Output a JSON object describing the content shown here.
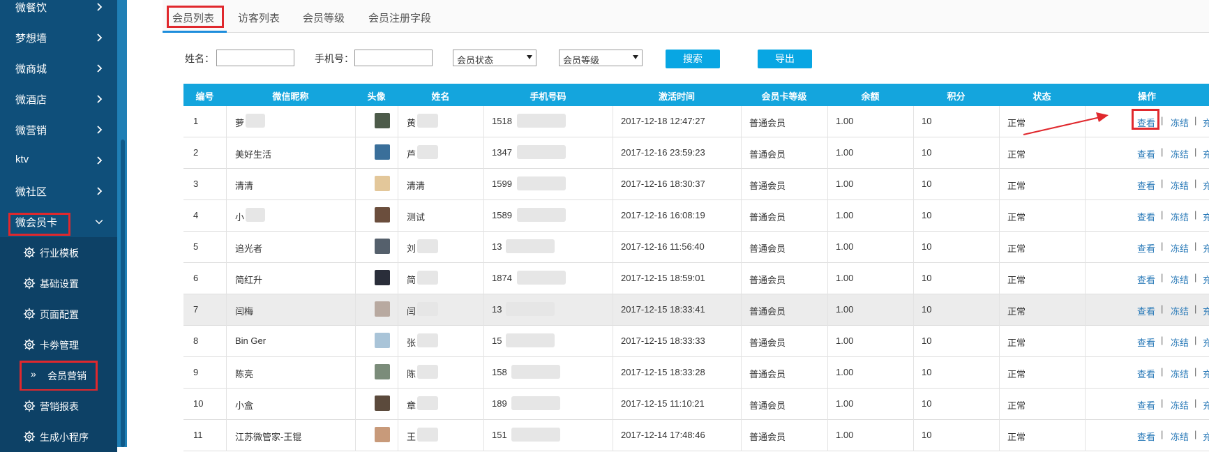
{
  "sidebar": {
    "menu": [
      {
        "label": "微餐饮"
      },
      {
        "label": "梦想墙"
      },
      {
        "label": "微商城"
      },
      {
        "label": "微酒店"
      },
      {
        "label": "微营销"
      },
      {
        "label": "ktv"
      },
      {
        "label": "微社区"
      },
      {
        "label": "微会员卡"
      }
    ],
    "submenu": [
      {
        "label": "行业模板"
      },
      {
        "label": "基础设置"
      },
      {
        "label": "页面配置"
      },
      {
        "label": "卡劵管理"
      },
      {
        "label": "会员营销"
      },
      {
        "label": "营销报表"
      },
      {
        "label": "生成小程序"
      }
    ],
    "active_prefix": "»"
  },
  "tabs": [
    {
      "label": "会员列表"
    },
    {
      "label": "访客列表"
    },
    {
      "label": "会员等级"
    },
    {
      "label": "会员注册字段"
    }
  ],
  "filters": {
    "name_label": "姓名：",
    "phone_label": "手机号：",
    "status_select": "会员状态",
    "level_select": "会员等级",
    "search_button": "搜索",
    "export_button": "导出"
  },
  "table": {
    "headers": [
      "编号",
      "微信昵称",
      "头像",
      "姓名",
      "手机号码",
      "激活时间",
      "会员卡等级",
      "余额",
      "积分",
      "状态",
      "操作"
    ],
    "ops": [
      "查看",
      "冻结",
      "充值"
    ],
    "op_sep": "|",
    "rows": [
      {
        "id": "1",
        "nick": "萝",
        "name": "黄",
        "phone": "1518",
        "time": "2017-12-18 12:47:27",
        "level": "普通会员",
        "balance": "1.00",
        "points": "10",
        "status": "正常"
      },
      {
        "id": "2",
        "nick": "美好生活",
        "name": "芦",
        "phone": "1347",
        "time": "2017-12-16 23:59:23",
        "level": "普通会员",
        "balance": "1.00",
        "points": "10",
        "status": "正常"
      },
      {
        "id": "3",
        "nick": "清清",
        "name": "清清",
        "phone": "1599",
        "time": "2017-12-16 18:30:37",
        "level": "普通会员",
        "balance": "1.00",
        "points": "10",
        "status": "正常"
      },
      {
        "id": "4",
        "nick": "小",
        "name": "测试",
        "phone": "1589",
        "time": "2017-12-16 16:08:19",
        "level": "普通会员",
        "balance": "1.00",
        "points": "10",
        "status": "正常"
      },
      {
        "id": "5",
        "nick": "追光者",
        "name": "刘",
        "phone": "13",
        "time": "2017-12-16 11:56:40",
        "level": "普通会员",
        "balance": "1.00",
        "points": "10",
        "status": "正常"
      },
      {
        "id": "6",
        "nick": "简红升",
        "name": "简",
        "phone": "1874",
        "time": "2017-12-15 18:59:01",
        "level": "普通会员",
        "balance": "1.00",
        "points": "10",
        "status": "正常"
      },
      {
        "id": "7",
        "nick": "闫梅",
        "name": "闫",
        "phone": "13",
        "time": "2017-12-15 18:33:41",
        "level": "普通会员",
        "balance": "1.00",
        "points": "10",
        "status": "正常"
      },
      {
        "id": "8",
        "nick": "Bin Ger",
        "name": "张",
        "phone": "15",
        "time": "2017-12-15 18:33:33",
        "level": "普通会员",
        "balance": "1.00",
        "points": "10",
        "status": "正常"
      },
      {
        "id": "9",
        "nick": "陈亮",
        "name": "陈",
        "phone": "158",
        "time": "2017-12-15 18:33:28",
        "level": "普通会员",
        "balance": "1.00",
        "points": "10",
        "status": "正常"
      },
      {
        "id": "10",
        "nick": "小盒",
        "name": "章",
        "phone": "189",
        "time": "2017-12-15 11:10:21",
        "level": "普通会员",
        "balance": "1.00",
        "points": "10",
        "status": "正常"
      },
      {
        "id": "11",
        "nick": "江苏微管家-王锟",
        "name": "王",
        "phone": "151",
        "time": "2017-12-14 17:48:46",
        "level": "普通会员",
        "balance": "1.00",
        "points": "10",
        "status": "正常"
      }
    ]
  },
  "colors": {
    "sidebar_bg": "#0f4f7a",
    "sidebar_sub_bg": "#0d4166",
    "header_bg": "#14a5dd",
    "button_bg": "#08a6e3",
    "link": "#2a7ab8",
    "highlight": "#e0282d"
  }
}
